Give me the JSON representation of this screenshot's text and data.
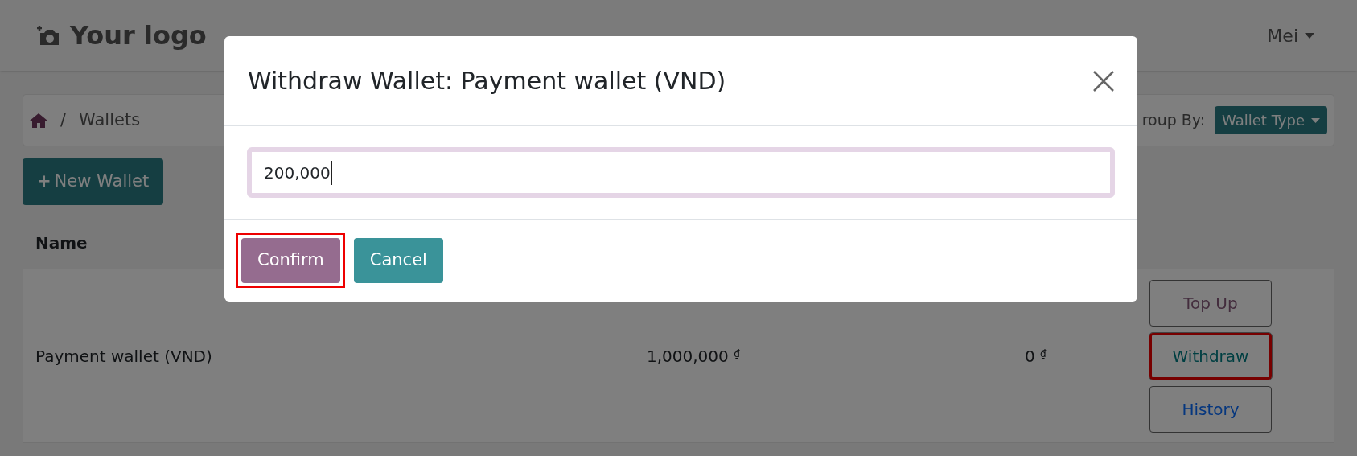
{
  "header": {
    "logo": "Your logo",
    "user": "Mei"
  },
  "breadcrumb": {
    "items": [
      "Wallets"
    ],
    "separator": "/"
  },
  "group_by": {
    "label": "roup By:",
    "value": "Wallet Type"
  },
  "new_button": {
    "icon": "+",
    "label": "New Wallet"
  },
  "table": {
    "columns": [
      "Name"
    ],
    "rows": [
      {
        "name": "Payment wallet (VND)",
        "balance": "1,000,000",
        "balance_currency": "₫",
        "column_3": "0",
        "column_3_currency": "₫",
        "actions": [
          {
            "label": "Top Up",
            "kind": "topup",
            "highlighted": false
          },
          {
            "label": "Withdraw",
            "kind": "withdraw",
            "highlighted": true
          },
          {
            "label": "History",
            "kind": "history",
            "highlighted": false
          }
        ]
      }
    ]
  },
  "dialog": {
    "title": "Withdraw Wallet: Payment wallet (VND)",
    "amount": "200,000",
    "buttons": [
      {
        "label": "Confirm",
        "kind": "primary",
        "highlighted": true
      },
      {
        "label": "Cancel",
        "kind": "secondary",
        "highlighted": false
      }
    ]
  }
}
